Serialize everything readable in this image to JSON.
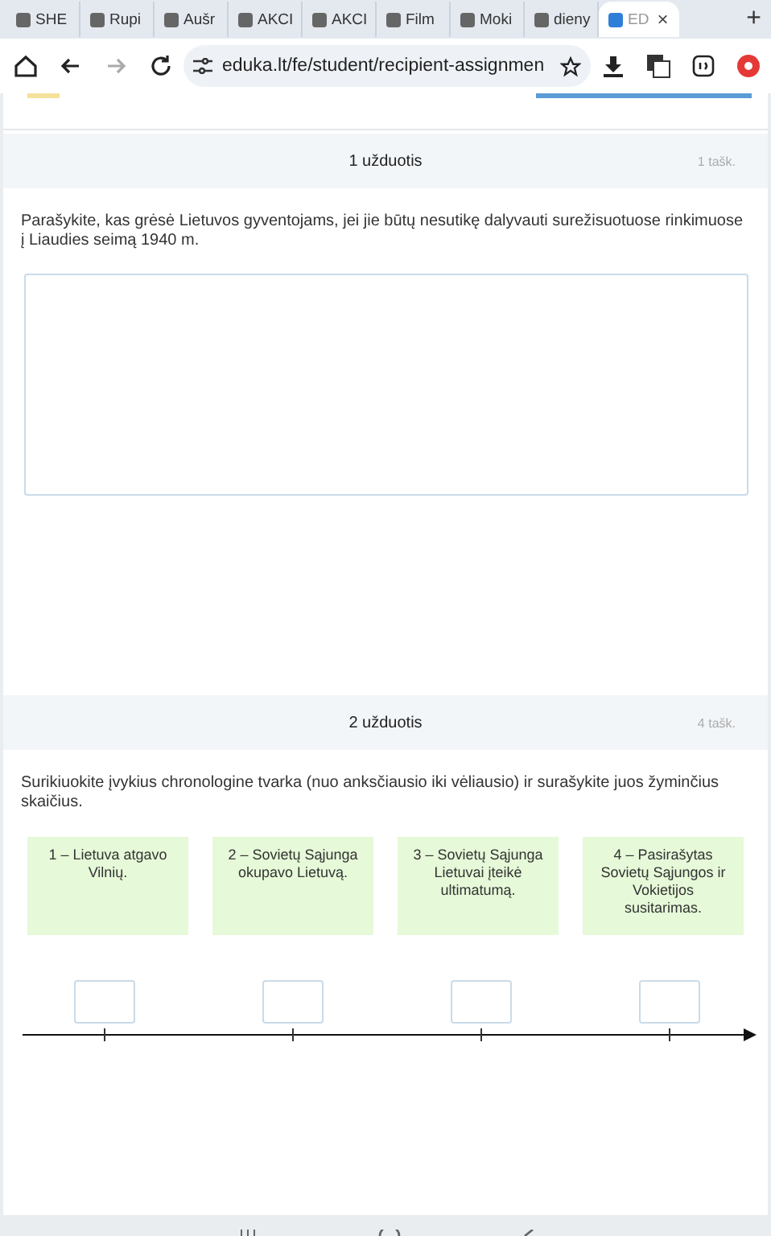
{
  "browser": {
    "tabs": [
      {
        "title": "SHE",
        "selected": false
      },
      {
        "title": "Rupi",
        "selected": false
      },
      {
        "title": "Aušr",
        "selected": false
      },
      {
        "title": "AKCI",
        "selected": false
      },
      {
        "title": "AKCI",
        "selected": false
      },
      {
        "title": "Film",
        "selected": false
      },
      {
        "title": "Moki",
        "selected": false
      },
      {
        "title": "dieny",
        "selected": false
      },
      {
        "title": "ED",
        "selected": true
      }
    ],
    "close_tab": "×",
    "new_tab": "+",
    "address": "eduka.lt/fe/student/recipient-assignmen"
  },
  "tasks": [
    {
      "kind": "text-answer",
      "title": "1 užduotis",
      "points": "1 tašk.",
      "question": "Parašykite, kas grėsė Lietuvos gyventojams, jei jie būtų nesutikę dalyvauti surežisuotuose rinkimuose į Liaudies seimą 1940 m."
    },
    {
      "kind": "timeline",
      "title": "2 užduotis",
      "points": "4 tašk.",
      "question": "Surikiuokite įvykius chronologine tvarka (nuo anksčiausio iki vėliausio) ir surašykite juos žyminčius skaičius.",
      "events": [
        "1 – Lietuva atgavo Vilnių.",
        "2 – Sovietų Sąjunga okupavo Lietuvą.",
        "3 – Sovietų Sąjunga Lietuvai įteikė ultimatumą.",
        "4 – Pasirašytas Sovietų Sąjungos ir Vokietijos susitarimas."
      ]
    }
  ]
}
